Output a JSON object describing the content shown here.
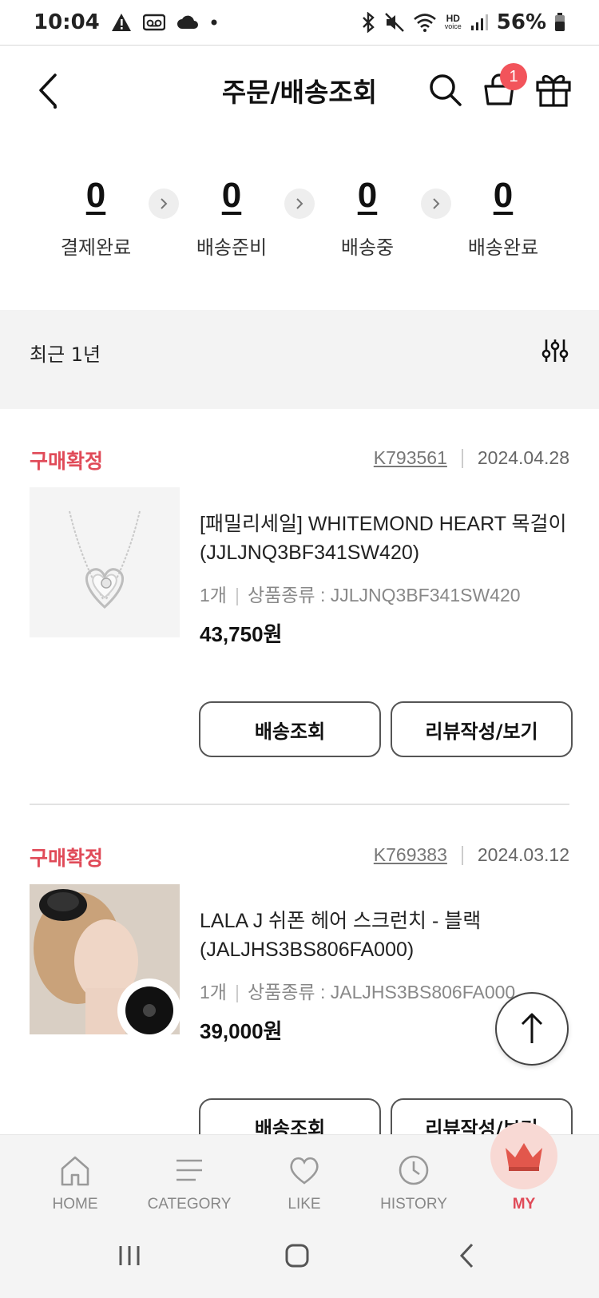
{
  "status_bar": {
    "time": "10:04",
    "battery": "56%",
    "left_icons": [
      "warning-icon",
      "voicemail-icon",
      "cloud-icon",
      "dot-icon"
    ],
    "right_icons": [
      "bluetooth-icon",
      "mute-icon",
      "wifi-icon",
      "hd-voice-icon",
      "signal-icon",
      "battery-icon"
    ],
    "hd_label": "HD",
    "voice_label": "voice"
  },
  "header": {
    "title": "주문/배송조회",
    "cart_badge": "1"
  },
  "summary": {
    "steps": [
      {
        "count": "0",
        "label": "결제완료"
      },
      {
        "count": "0",
        "label": "배송준비"
      },
      {
        "count": "0",
        "label": "배송중"
      },
      {
        "count": "0",
        "label": "배송완료"
      }
    ]
  },
  "filter": {
    "label": "최근 1년"
  },
  "orders": [
    {
      "status": "구매확정",
      "order_no": "K793561",
      "date": "2024.04.28",
      "product_name": "[패밀리세일] WHITEMOND HEART 목걸이 (JJLJNQ3BF341SW420)",
      "qty": "1개",
      "option": "상품종류 : JJLJNQ3BF341SW420",
      "price": "43,750원",
      "buttons": [
        "배송조회",
        "리뷰작성/보기"
      ]
    },
    {
      "status": "구매확정",
      "order_no": "K769383",
      "date": "2024.03.12",
      "product_name": "LALA J 쉬폰 헤어 스크런치 - 블랙 (JALJHS3BS806FA000)",
      "qty": "1개",
      "option": "상품종류 : JALJHS3BS806FA000",
      "price": "39,000원",
      "buttons": [
        "배송조회",
        "리뷰작성/보기"
      ]
    }
  ],
  "bottom_nav": [
    {
      "label": "HOME",
      "icon": "home-icon"
    },
    {
      "label": "CATEGORY",
      "icon": "menu-icon"
    },
    {
      "label": "LIKE",
      "icon": "heart-icon"
    },
    {
      "label": "HISTORY",
      "icon": "clock-icon"
    },
    {
      "label": "MY",
      "icon": "crown-icon",
      "active": true
    }
  ],
  "colors": {
    "accent": "#e04a58",
    "badge": "#f2545b",
    "filter_bg": "#f3f3f3"
  }
}
